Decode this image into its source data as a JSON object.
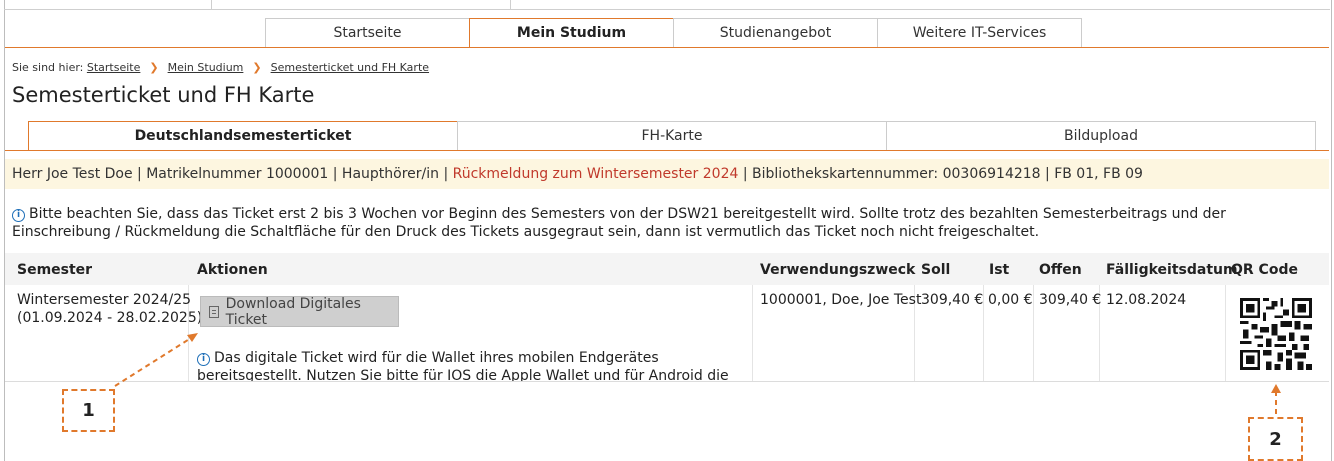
{
  "nav": {
    "tabs": [
      {
        "label": "Startseite"
      },
      {
        "label": "Mein Studium"
      },
      {
        "label": "Studienangebot"
      },
      {
        "label": "Weitere IT-Services"
      }
    ]
  },
  "breadcrumb": {
    "prefix": "Sie sind hier:",
    "items": [
      "Startseite",
      "Mein Studium",
      "Semesterticket und FH Karte"
    ]
  },
  "page": {
    "title": "Semesterticket und FH Karte"
  },
  "subtabs": [
    "Deutschlandsemesterticket",
    "FH-Karte",
    "Bildupload"
  ],
  "student_info": {
    "part1": "Herr Joe Test Doe | Matrikelnummer 1000001 | Haupthörer/in | ",
    "highlight": "Rückmeldung zum Wintersemester 2024",
    "part2": " | Bibliothekskartennummer: 00306914218 | FB 01, FB 09"
  },
  "notice": "Bitte beachten Sie, dass das Ticket erst 2 bis 3 Wochen vor Beginn des Semesters von der DSW21 bereitgestellt wird. Sollte trotz des bezahlten Semesterbeitrags und der Einschreibung / Rückmeldung die Schaltfläche für den Druck des Tickets ausgegraut sein, dann ist vermutlich das Ticket noch nicht freigeschaltet.",
  "table": {
    "headers": {
      "semester": "Semester",
      "aktionen": "Aktionen",
      "verwendungszweck": "Verwendungszweck",
      "soll": "Soll",
      "ist": "Ist",
      "offen": "Offen",
      "faelligkeit": "Fälligkeitsdatum",
      "qr": "QR Code"
    },
    "row": {
      "semester_line1": "Wintersemester 2024/25",
      "semester_line2": "(01.09.2024 - 28.02.2025)",
      "download_label": "Download Digitales Ticket",
      "wallet_note": "Das digitale Ticket wird für die Wallet ihres mobilen Endgerätes bereitsgestellt. Nutzen Sie bitte für IOS die Apple Wallet und für Android die Passbook Wallet.",
      "verwendungszweck": "1000001, Doe, Joe Test",
      "soll": "309,40 €",
      "ist": "0,00 €",
      "offen": "309,40 €",
      "faelligkeit": "12.08.2024"
    }
  },
  "annotations": {
    "label1": "1",
    "label2": "2"
  },
  "colors": {
    "accent": "#e0792c",
    "highlight_text": "#c0392b",
    "info_bg": "#fdf6e0",
    "info_icon": "#1e6fb8"
  },
  "icons": [
    "info-icon",
    "ticket-icon",
    "qr-code",
    "chevron-right-icon"
  ]
}
